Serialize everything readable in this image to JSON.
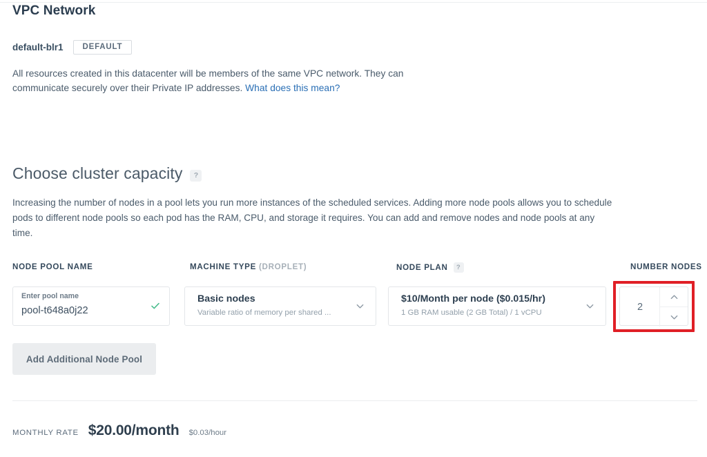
{
  "vpc": {
    "title": "VPC Network",
    "network_name": "default-blr1",
    "badge": "DEFAULT",
    "description": "All resources created in this datacenter will be members of the same VPC network. They can communicate securely over their Private IP addresses. ",
    "link_text": "What does this mean?",
    "link_color": "#2a6fb5"
  },
  "capacity": {
    "heading": "Choose cluster capacity",
    "help_glyph": "?",
    "description": "Increasing the number of nodes in a pool lets you run more instances of the scheduled services. Adding more node pools allows you to schedule pods to different node pools so each pod has the RAM, CPU, and storage it requires. You can add and remove nodes and node pools at any time."
  },
  "fields": {
    "node_pool_name": {
      "label": "NODE POOL NAME",
      "placeholder": "Enter pool name",
      "value": "pool-t648a0j22",
      "valid_icon": "check-icon",
      "valid_color": "#4bbd8e"
    },
    "machine_type": {
      "label_main": "MACHINE TYPE",
      "label_muted": "(DROPLET)",
      "selected_title": "Basic nodes",
      "selected_subtitle": "Variable ratio of memory per shared ..."
    },
    "node_plan": {
      "label": "NODE PLAN",
      "help_glyph": "?",
      "selected_title": "$10/Month per node ($0.015/hr)",
      "selected_subtitle": "1 GB RAM usable (2 GB Total) / 1 vCPU"
    },
    "number_nodes": {
      "label": "NUMBER NODES",
      "value": "2",
      "highlight_color": "#e01f26"
    }
  },
  "actions": {
    "add_node_pool": "Add Additional Node Pool"
  },
  "footer": {
    "rate_label": "MONTHLY RATE",
    "rate_monthly": "$20.00/month",
    "rate_hourly": "$0.03/hour"
  }
}
